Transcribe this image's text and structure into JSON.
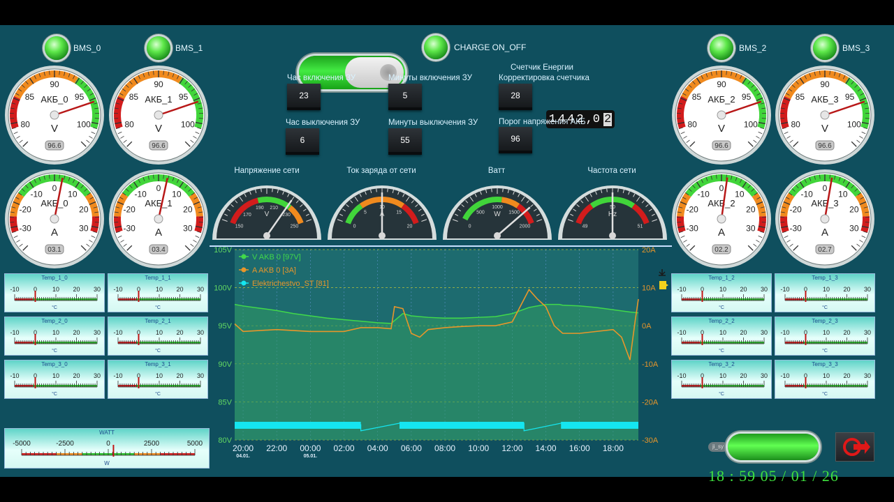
{
  "bms_leds": [
    {
      "label": "BMS_0"
    },
    {
      "label": "BMS_1"
    },
    {
      "label": "BMS_2"
    },
    {
      "label": "BMS_3"
    }
  ],
  "charge_toggle": {
    "label": "CHARGE ON_OFF",
    "state": "on"
  },
  "fields": {
    "charge_on_hour": {
      "label": "Час включения ЗУ",
      "value": "23"
    },
    "charge_on_min": {
      "label": "Минуты включения ЗУ",
      "value": "5"
    },
    "charge_off_hour": {
      "label": "Час выключения ЗУ",
      "value": "6"
    },
    "charge_off_min": {
      "label": "Минуты выключения ЗУ",
      "value": "55"
    },
    "counter_correction": {
      "label": "Корректировка счетчика",
      "value": "28"
    },
    "voltage_threshold": {
      "label": "Порог напряжения АКБ",
      "value": "96"
    }
  },
  "energy_counter": {
    "title": "Счетчик Енергии",
    "digits": "1442",
    "decimal": "0",
    "extra": "2"
  },
  "voltage_gauges": [
    {
      "name": "АКБ_0",
      "unit": "V",
      "readout": "96.6",
      "value": 96.6,
      "ticks": [
        "80",
        "85",
        "90",
        "95",
        "100"
      ]
    },
    {
      "name": "АКБ_1",
      "unit": "V",
      "readout": "96.6",
      "value": 96.6,
      "ticks": [
        "80",
        "85",
        "90",
        "95",
        "100"
      ]
    },
    {
      "name": "АКБ_2",
      "unit": "V",
      "readout": "96.6",
      "value": 96.6,
      "ticks": [
        "80",
        "85",
        "90",
        "95",
        "100"
      ]
    },
    {
      "name": "АКБ_3",
      "unit": "V",
      "readout": "96.6",
      "value": 96.6,
      "ticks": [
        "80",
        "85",
        "90",
        "95",
        "100"
      ]
    }
  ],
  "current_gauges": [
    {
      "name": "АКБ_0",
      "unit": "A",
      "readout": "03.1",
      "value": 3.1,
      "ticks": [
        "-30",
        "-20",
        "-10",
        "0",
        "10",
        "20",
        "30"
      ]
    },
    {
      "name": "АКБ_1",
      "unit": "A",
      "readout": "03.4",
      "value": 3.4,
      "ticks": [
        "-30",
        "-20",
        "-10",
        "0",
        "10",
        "20",
        "30"
      ]
    },
    {
      "name": "АКБ_2",
      "unit": "A",
      "readout": "02.2",
      "value": 2.2,
      "ticks": [
        "-30",
        "-20",
        "-10",
        "0",
        "10",
        "20",
        "30"
      ]
    },
    {
      "name": "АКБ_3",
      "unit": "A",
      "readout": "02.7",
      "value": 2.7,
      "ticks": [
        "-30",
        "-20",
        "-10",
        "0",
        "10",
        "20",
        "30"
      ]
    }
  ],
  "mains_gauges": [
    {
      "title": "Напряжение сети",
      "unit": "V",
      "ticks": [
        "150",
        "170",
        "190",
        "210",
        "230",
        "250"
      ],
      "min": 150,
      "max": 250,
      "value": 225
    },
    {
      "title": "Ток заряда от сети",
      "unit": "A",
      "ticks": [
        "0",
        "5",
        "10",
        "15",
        "20"
      ],
      "min": 0,
      "max": 20,
      "value": 10
    },
    {
      "title": "Ватт",
      "unit": "W",
      "ticks": [
        "0",
        "500",
        "1000",
        "1500",
        "2000"
      ],
      "min": 0,
      "max": 2000,
      "value": 1700
    },
    {
      "title": "Частота сети",
      "unit": "Hz",
      "ticks": [
        "49",
        "50",
        "51"
      ],
      "min": 49,
      "max": 51,
      "value": 50
    }
  ],
  "temp_panels": [
    {
      "title": "Temp_1_0",
      "value": 0
    },
    {
      "title": "Temp_1_1",
      "value": 0
    },
    {
      "title": "Temp_2_0",
      "value": 0
    },
    {
      "title": "Temp_2_1",
      "value": 0
    },
    {
      "title": "Temp_3_0",
      "value": 0
    },
    {
      "title": "Temp_3_1",
      "value": 0
    },
    {
      "title": "Temp_1_2",
      "value": 0
    },
    {
      "title": "Temp_1_3",
      "value": 0
    },
    {
      "title": "Temp_2_2",
      "value": 0
    },
    {
      "title": "Temp_2_3",
      "value": 0
    },
    {
      "title": "Temp_3_2",
      "value": 0
    },
    {
      "title": "Temp_3_3",
      "value": 0
    }
  ],
  "temp_scale": {
    "ticks": [
      "-10",
      "0",
      "10",
      "20",
      "30"
    ],
    "unit": "°C"
  },
  "watt_panel": {
    "title": "WATT",
    "unit": "W",
    "ticks": [
      "-5000",
      "-2500",
      "0",
      "2500",
      "5000"
    ],
    "value": 300
  },
  "chart_data": {
    "type": "line",
    "x_ticks": [
      "20:00",
      "22:00",
      "00:00",
      "02:00",
      "04:00",
      "06:00",
      "08:00",
      "10:00",
      "12:00",
      "14:00",
      "16:00",
      "18:00"
    ],
    "date_labels": [
      {
        "tick": "20:00",
        "label": "04.01."
      },
      {
        "tick": "00:00",
        "label": "05.01."
      }
    ],
    "y_left_ticks": [
      "105V",
      "100V",
      "95V",
      "90V",
      "85V",
      "80V"
    ],
    "y_right_ticks": [
      "20A",
      "10A",
      "0A",
      "-10A",
      "-20A",
      "-30A"
    ],
    "ylim_left": [
      80,
      105
    ],
    "ylim_right": [
      -30,
      20
    ],
    "legend": [
      {
        "name": "V AKB 0 [97V]",
        "color": "#41d94a"
      },
      {
        "name": "A AKB 0 [3A]",
        "color": "#e8962a"
      },
      {
        "name": "Elektrichestvo_ST [81]",
        "color": "#15e6f0"
      }
    ],
    "series": [
      {
        "name": "V AKB 0 [97V]",
        "x": [
          19.5,
          20,
          21,
          22,
          23,
          24,
          25,
          26,
          27,
          28,
          28.8,
          29.5,
          30,
          31,
          32,
          33,
          34,
          35,
          36,
          37,
          38,
          38.8,
          39,
          40,
          41,
          42,
          43,
          43.5
        ],
        "values": [
          97.8,
          97.6,
          97.3,
          97.0,
          96.6,
          96.3,
          96.0,
          95.8,
          95.6,
          95.4,
          95.3,
          96.6,
          96.3,
          96.1,
          96.0,
          96.0,
          96.1,
          96.2,
          96.6,
          97.4,
          97.8,
          97.8,
          97.7,
          97.6,
          97.4,
          97.1,
          96.8,
          96.7
        ]
      },
      {
        "name": "A AKB 0 [3A]",
        "x": [
          19.5,
          20,
          22,
          24,
          26,
          27,
          28,
          28.8,
          29,
          29.5,
          30,
          30.5,
          31,
          32,
          33,
          34,
          35,
          36,
          37,
          37.5,
          38,
          38.5,
          39,
          40,
          41,
          42,
          42.5,
          43,
          43.3,
          43.5
        ],
        "values": [
          0.5,
          -1.5,
          -1,
          -1.5,
          -1.5,
          -0.5,
          -0.5,
          -0.8,
          5,
          4.5,
          -2,
          -3,
          -1,
          -0.5,
          -0.2,
          0,
          0,
          1,
          9.5,
          7,
          5,
          0,
          -2,
          -2,
          -1.5,
          -1,
          -3,
          -9,
          1,
          7
        ]
      },
      {
        "name": "Elektrichestvo_ST [81]",
        "x": [
          19.5,
          27.0,
          27.0,
          29.3,
          29.3,
          36.7,
          36.7,
          38.9,
          38.9,
          43.5
        ],
        "values": [
          82,
          82,
          81.2,
          82.2,
          82.2,
          82.2,
          81.2,
          82.2,
          82.2,
          82.2
        ]
      }
    ]
  },
  "status_pill": "ji_sy",
  "clock": {
    "time": "18 : 59",
    "date": "05 / 01 / 26"
  }
}
